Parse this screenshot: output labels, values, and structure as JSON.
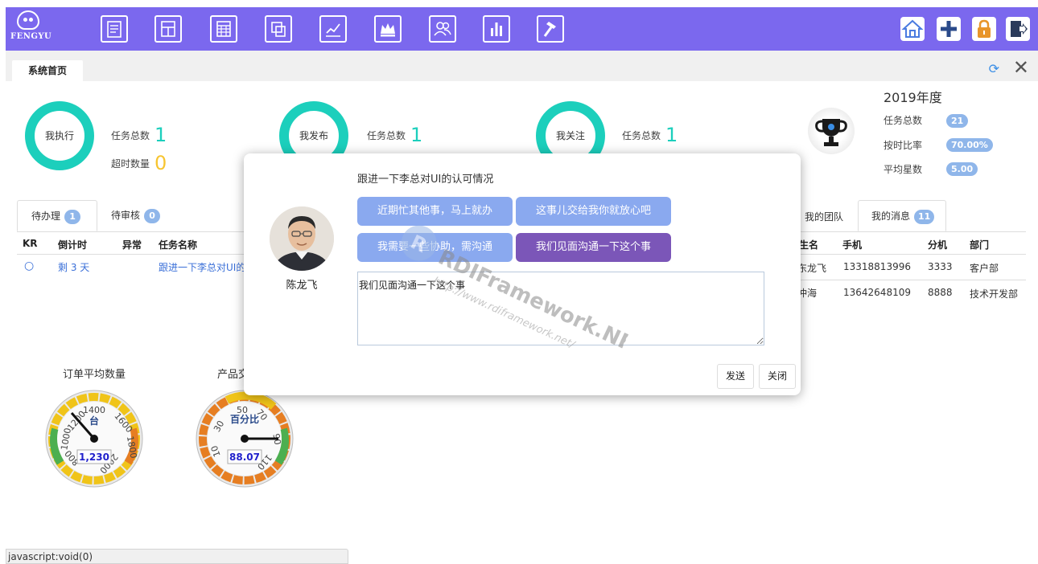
{
  "topbar": {
    "logo_text": "FENGYU",
    "nav_icons": [
      "report-icon",
      "layout-icon",
      "table-icon",
      "module-icon",
      "chart-line-icon",
      "crown-icon",
      "users-icon",
      "bar-chart-icon",
      "hammer-icon"
    ],
    "right_icons": [
      "home-icon",
      "plus-icon",
      "lock-icon",
      "exit-icon"
    ],
    "bar_color": "#7b68ee"
  },
  "tabs": {
    "home": "系统首页"
  },
  "donuts": [
    {
      "label": "我执行",
      "stats": [
        {
          "label": "任务总数",
          "value": "1"
        },
        {
          "label": "超时数量",
          "value": "0"
        }
      ]
    },
    {
      "label": "我发布",
      "stats": [
        {
          "label": "任务总数",
          "value": "1"
        }
      ]
    },
    {
      "label": "我关注",
      "stats": [
        {
          "label": "任务总数",
          "value": "1"
        }
      ]
    }
  ],
  "summary": {
    "year": "2019年度",
    "rows": [
      {
        "label": "任务总数",
        "value": "21"
      },
      {
        "label": "按时比率",
        "value": "70.00%"
      },
      {
        "label": "平均星数",
        "value": "5.00"
      }
    ]
  },
  "task_tabs": [
    {
      "label": "待办理",
      "count": "1"
    },
    {
      "label": "待审核",
      "count": "0"
    }
  ],
  "task_table": {
    "headers": [
      "KR",
      "倒计时",
      "异常",
      "任务名称"
    ],
    "rows": [
      {
        "kr": "○",
        "countdown": "剩 3 天",
        "abnormal": "",
        "name": "跟进一下李总对UI的"
      }
    ]
  },
  "team_tabs": [
    {
      "label": "我的团队",
      "count": ""
    },
    {
      "label": "我的消息",
      "count": "11"
    }
  ],
  "team_table": {
    "headers": [
      "姓名",
      "手机",
      "分机",
      "部门"
    ],
    "header_visible": [
      "生名",
      "手机",
      "分机",
      "部门"
    ],
    "rows": [
      {
        "name": "陈龙飞",
        "name_visible": "东龙飞",
        "phone": "13318813996",
        "ext": "3333",
        "dept": "客户部"
      },
      {
        "name": "冲海",
        "name_visible": "冲海",
        "phone": "13642648109",
        "ext": "8888",
        "dept": "技术开发部"
      }
    ]
  },
  "gauges": [
    {
      "title": "订单平均数量",
      "unit": "台",
      "value": "1,230",
      "ticks": [
        "1000",
        "1200",
        "1400",
        "1600",
        "1800",
        "2000",
        "800"
      ]
    },
    {
      "title": "产品交",
      "unit": "百分比",
      "value": "88.07",
      "ticks": [
        "10",
        "30",
        "50",
        "70",
        "90",
        "110"
      ]
    }
  ],
  "modal": {
    "title": "跟进一下李总对UI的认可情况",
    "person_name": "陈龙飞",
    "quick_replies": [
      {
        "label": "近期忙其他事，马上就办",
        "active": false
      },
      {
        "label": "这事儿交给我你就放心吧",
        "active": false
      },
      {
        "label": "我需要一些协助，需沟通",
        "active": false
      },
      {
        "label": "我们见面沟通一下这个事",
        "active": true
      }
    ],
    "message": "我们见面沟通一下这个事",
    "send_label": "发送",
    "close_label": "关闭"
  },
  "watermark": {
    "line1": "RDIFramework.NET",
    "line2": "http://www.rdiframework.net/"
  },
  "statusbar": "javascript:void(0)"
}
